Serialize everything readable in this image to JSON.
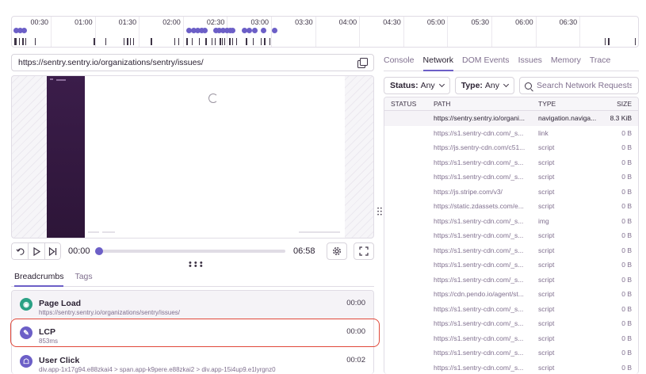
{
  "timeline": {
    "labels": [
      "00:30",
      "01:00",
      "01:30",
      "02:00",
      "02:30",
      "03:00",
      "03:30",
      "04:00",
      "04:30",
      "05:00",
      "05:30",
      "06:00",
      "06:30"
    ]
  },
  "replay": {
    "url": "https://sentry.sentry.io/organizations/sentry/issues/",
    "current_time": "00:00",
    "total_time": "06:58",
    "progress": 0
  },
  "breadcrumbs": {
    "tabs": [
      "Breadcrumbs",
      "Tags"
    ],
    "items": [
      {
        "title": "Page Load",
        "subtitle": "https://sentry.sentry.io/organizations/sentry/issues/",
        "time": "00:00",
        "icon": "pageload-icon",
        "color": "#2ba185"
      },
      {
        "title": "LCP",
        "subtitle": "853ms",
        "time": "00:00",
        "icon": "wrench-icon",
        "color": "#6c5fc7"
      },
      {
        "title": "User Click",
        "subtitle": "div.app-1x17g94.e88zkai4 > span.app-k9pere.e88zkai2 > div.app-15i4up9.e1lyrgnz0",
        "time": "00:02",
        "icon": "user-icon",
        "color": "#6c5fc7"
      }
    ]
  },
  "right": {
    "tabs": [
      "Console",
      "Network",
      "DOM Events",
      "Issues",
      "Memory",
      "Trace"
    ],
    "active_tab": "Network",
    "filters": [
      {
        "label": "Status:",
        "value": "Any"
      },
      {
        "label": "Type:",
        "value": "Any"
      }
    ],
    "search_placeholder": "Search Network Requests"
  },
  "network": {
    "columns": [
      "STATUS",
      "PATH",
      "TYPE",
      "SIZE"
    ],
    "rows": [
      {
        "status": "",
        "path": "https://sentry.sentry.io/organi...",
        "type": "navigation.naviga...",
        "size": "8.3 KiB"
      },
      {
        "status": "",
        "path": "https://s1.sentry-cdn.com/_s...",
        "type": "link",
        "size": "0 B"
      },
      {
        "status": "",
        "path": "https://js.sentry-cdn.com/c51...",
        "type": "script",
        "size": "0 B"
      },
      {
        "status": "",
        "path": "https://s1.sentry-cdn.com/_s...",
        "type": "script",
        "size": "0 B"
      },
      {
        "status": "",
        "path": "https://s1.sentry-cdn.com/_s...",
        "type": "script",
        "size": "0 B"
      },
      {
        "status": "",
        "path": "https://js.stripe.com/v3/",
        "type": "script",
        "size": "0 B"
      },
      {
        "status": "",
        "path": "https://static.zdassets.com/e...",
        "type": "script",
        "size": "0 B"
      },
      {
        "status": "",
        "path": "https://s1.sentry-cdn.com/_s...",
        "type": "img",
        "size": "0 B"
      },
      {
        "status": "",
        "path": "https://s1.sentry-cdn.com/_s...",
        "type": "script",
        "size": "0 B"
      },
      {
        "status": "",
        "path": "https://s1.sentry-cdn.com/_s...",
        "type": "script",
        "size": "0 B"
      },
      {
        "status": "",
        "path": "https://s1.sentry-cdn.com/_s...",
        "type": "script",
        "size": "0 B"
      },
      {
        "status": "",
        "path": "https://s1.sentry-cdn.com/_s...",
        "type": "script",
        "size": "0 B"
      },
      {
        "status": "",
        "path": "https://cdn.pendo.io/agent/st...",
        "type": "script",
        "size": "0 B"
      },
      {
        "status": "",
        "path": "https://s1.sentry-cdn.com/_s...",
        "type": "script",
        "size": "0 B"
      },
      {
        "status": "",
        "path": "https://s1.sentry-cdn.com/_s...",
        "type": "script",
        "size": "0 B"
      },
      {
        "status": "",
        "path": "https://s1.sentry-cdn.com/_s...",
        "type": "script",
        "size": "0 B"
      },
      {
        "status": "",
        "path": "https://s1.sentry-cdn.com/_s...",
        "type": "script",
        "size": "0 B"
      },
      {
        "status": "",
        "path": "https://s1.sentry-cdn.com/_s...",
        "type": "script",
        "size": "0 B"
      }
    ]
  },
  "colors": {
    "accent": "#6c5fc7",
    "highlight": "#e0483a",
    "success": "#2ba185"
  }
}
